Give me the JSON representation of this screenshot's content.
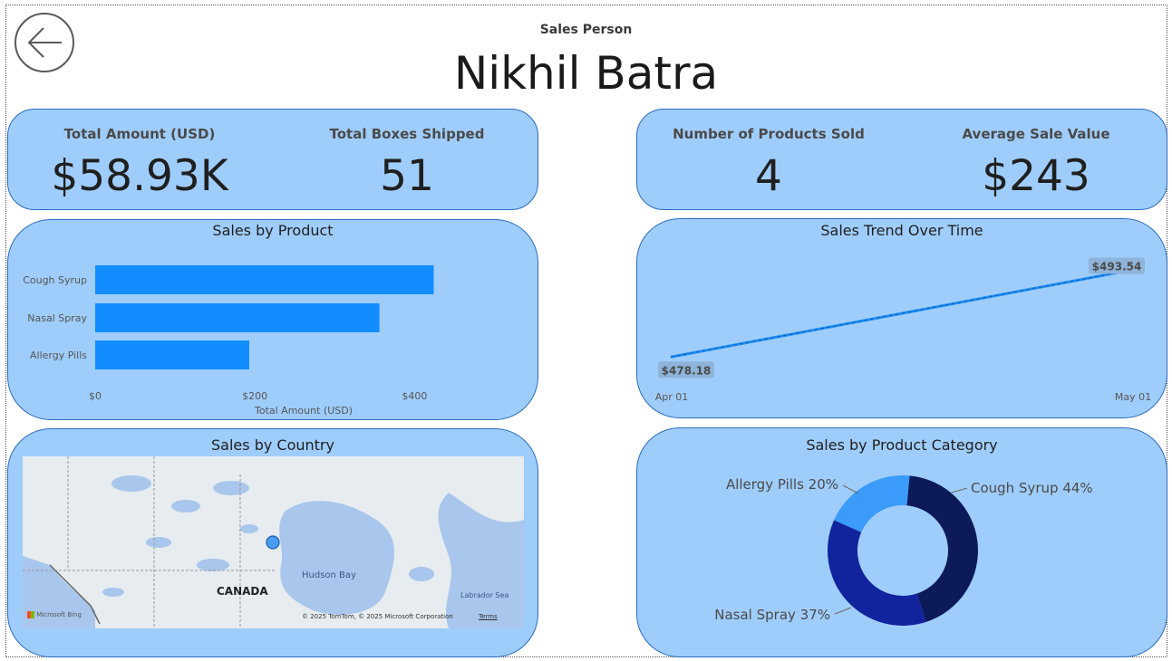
{
  "header": {
    "subtitle": "Sales Person",
    "title": "Nikhil Batra"
  },
  "kpis_left": [
    {
      "label": "Total Amount (USD)",
      "value": "$58.93K"
    },
    {
      "label": "Total Boxes Shipped",
      "value": "51"
    }
  ],
  "kpis_right": [
    {
      "label": "Number of Products Sold",
      "value": "4"
    },
    {
      "label": "Average Sale Value",
      "value": "$243"
    }
  ],
  "sales_by_product": {
    "title": "Sales by Product",
    "xlabel": "Total Amount (USD)",
    "ticks": [
      "$0",
      "$200",
      "$400"
    ],
    "chart_data": {
      "type": "bar",
      "categories": [
        "Cough Syrup",
        "Nasal Spray",
        "Allergy Pills"
      ],
      "values": [
        424,
        356,
        193
      ],
      "xlim": [
        0,
        420
      ],
      "color": "#118dff"
    }
  },
  "sales_trend": {
    "title": "Sales Trend Over Time",
    "chart_data": {
      "type": "line",
      "x": [
        "Apr 01",
        "May 01"
      ],
      "values": [
        478.18,
        493.54
      ],
      "labels": [
        "$478.18",
        "$493.54"
      ],
      "color": "#1f8ff5"
    }
  },
  "sales_by_country": {
    "title": "Sales by Country",
    "labels": {
      "country": "CANADA",
      "bay": "Hudson Bay",
      "sea": "Labrador Sea",
      "brand": "Microsoft Bing",
      "copyright": "© 2025 TomTom, © 2025 Microsoft Corporation",
      "terms": "Terms"
    }
  },
  "sales_by_category": {
    "title": "Sales by Product Category",
    "chart_data": {
      "type": "pie",
      "categories": [
        "Cough Syrup",
        "Nasal Spray",
        "Allergy Pills"
      ],
      "values": [
        44,
        37,
        20
      ],
      "labels": [
        "Cough Syrup 44%",
        "Nasal Spray 37%",
        "Allergy Pills 20%"
      ],
      "colors": [
        "#0c1a5a",
        "#12239e",
        "#3a9bfa"
      ]
    }
  },
  "icons": {
    "back": "back-arrow-icon"
  }
}
